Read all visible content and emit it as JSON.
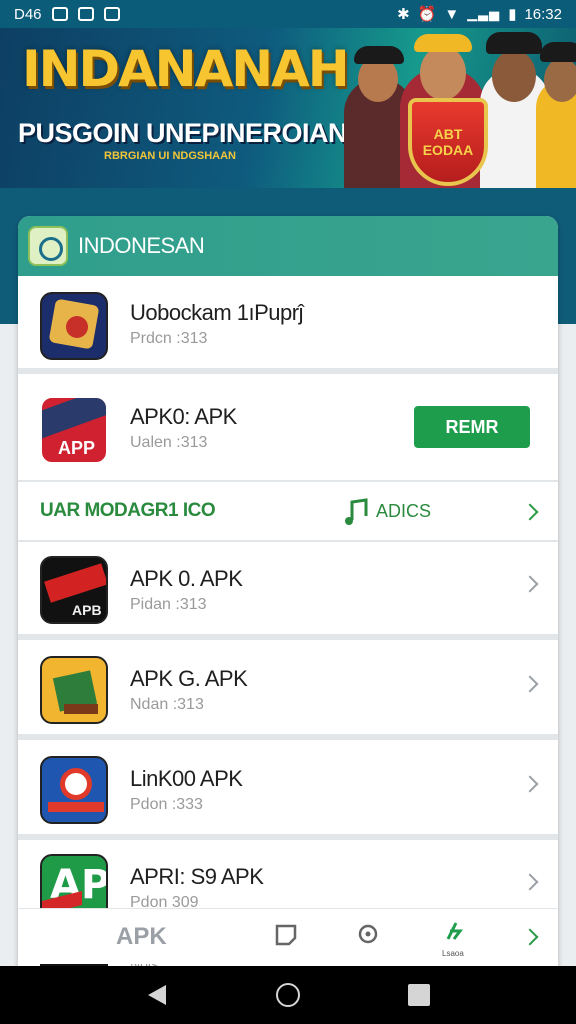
{
  "status_bar": {
    "left_text": "D46",
    "time": "16:32"
  },
  "banner": {
    "title": "INDANANAH",
    "subtitle": "PUSGOIN UNEPINEROIAN",
    "small_text": "RBRGIAN UI NDGSHAAN",
    "shield_text": "ABT EODAA"
  },
  "card": {
    "header_title": "INDONESAN",
    "rows": [
      {
        "name": "Uobockam 1ıPuprĵ",
        "sub": "Prdcn :313"
      },
      {
        "name": "APK0: APK",
        "sub": "Ualen :313",
        "button": "REMR"
      },
      {
        "name": "APK 0. APK",
        "sub": "Pidan :313"
      },
      {
        "name": "APK G. APK",
        "sub": "Ndan :313"
      },
      {
        "name": "LinK00 APK",
        "sub": "Pdon :333"
      },
      {
        "name": "APRI: S9 APK",
        "sub": "Pdon 309"
      }
    ],
    "promo": {
      "left": "UAR MODAGR1 ICO",
      "right": "ADICS"
    },
    "tabbar": {
      "apk_label": "APK",
      "sub_label": "Lsaoa"
    },
    "peek_sub": "Nols"
  },
  "colors": {
    "teal": "#0f5c79",
    "accent_green": "#1e9e4d",
    "banner_gold": "#f6c530"
  },
  "icons": [
    "bluetooth-icon",
    "alarm-icon",
    "wifi-icon",
    "signal-icon",
    "battery-icon"
  ]
}
